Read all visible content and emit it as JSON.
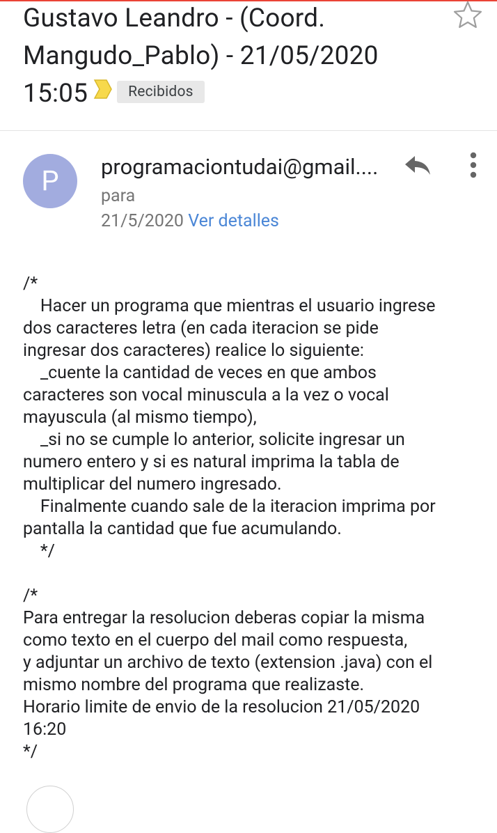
{
  "email": {
    "subject": "Gustavo Leandro - (Coord.\nMangudo_Pablo) - 21/05/2020\n15:05",
    "label": "Recibidos",
    "avatar_letter": "P",
    "sender": "programaciontudai@gmail....",
    "recipient_prefix": "para",
    "date": "21/5/2020",
    "details_link": "Ver detalles",
    "body": "/*\n    Hacer un programa que mientras el usuario ingrese\ndos caracteres letra (en cada iteracion se pide\ningresar dos caracteres) realice lo siguiente:\n    _cuente la cantidad de veces en que ambos\ncaracteres son vocal minuscula a la vez o vocal\nmayuscula (al mismo tiempo),\n    _si no se cumple lo anterior, solicite ingresar un\nnumero entero y si es natural imprima la tabla de\nmultiplicar del numero ingresado.\n    Finalmente cuando sale de la iteracion imprima por\npantalla la cantidad que fue acumulando.\n    */\n\n/*\nPara entregar la resolucion deberas copiar la misma\ncomo texto en el cuerpo del mail como respuesta,\ny adjuntar un archivo de texto (extension .java) con el\nmismo nombre del programa que realizaste.\nHorario limite de envio de la resolucion 21/05/2020\n16:20\n*/"
  },
  "icons": {
    "star": "star-outline-icon",
    "importance": "importance-marker-icon",
    "reply": "reply-icon",
    "more": "more-vert-icon"
  },
  "colors": {
    "accent_link": "#4a86d6",
    "avatar_bg": "#a2acdf",
    "importance": "#f7d94c",
    "label_chip_bg": "#e8e8e8",
    "top_bar": "#ea4335"
  }
}
